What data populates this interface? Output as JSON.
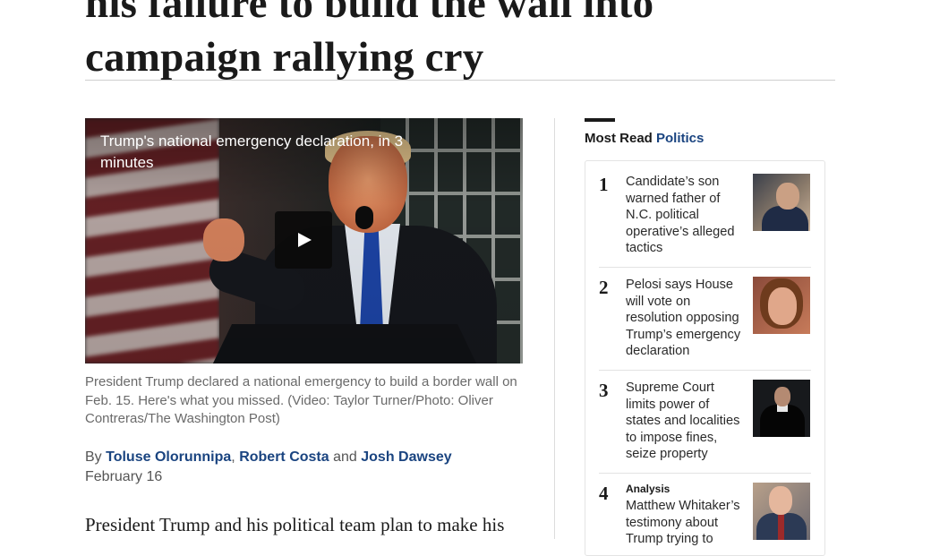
{
  "article": {
    "headline_line1": "his failure to build the wall into",
    "headline_line2": "campaign rallying cry",
    "video_title": "Trump's national emergency declaration, in 3 minutes",
    "caption": "President Trump declared a national emergency to build a border wall on Feb. 15. Here's what you missed. (Video: Taylor Turner/Photo: Oliver Contreras/The Washington Post)",
    "byline": {
      "prefix": "By",
      "author1": "Toluse Olorunnipa",
      "sep1": ",",
      "author2": "Robert Costa",
      "conj": "and",
      "author3": "Josh Dawsey"
    },
    "date": "February 16",
    "lede": "President Trump and his political team plan to make his"
  },
  "most_read": {
    "label": "Most Read",
    "section": "Politics",
    "items": [
      {
        "num": "1",
        "label": "",
        "text": "Candidate’s son warned father of N.C. political operative’s alleged tactics",
        "thumb_icon": "portrait-man-icon"
      },
      {
        "num": "2",
        "label": "",
        "text": "Pelosi says House will vote on resolution opposing Trump’s emergency declaration",
        "thumb_icon": "portrait-woman-icon"
      },
      {
        "num": "3",
        "label": "",
        "text": "Supreme Court limits power of states and localities to impose fines, seize property",
        "thumb_icon": "portrait-justice-icon"
      },
      {
        "num": "4",
        "label": "Analysis",
        "text": "Matthew Whitaker’s testimony about Trump trying to",
        "thumb_icon": "portrait-man-icon"
      }
    ]
  },
  "colors": {
    "link": "#1a4480",
    "text": "#1a1a1a",
    "caption": "#6a6a6a"
  }
}
